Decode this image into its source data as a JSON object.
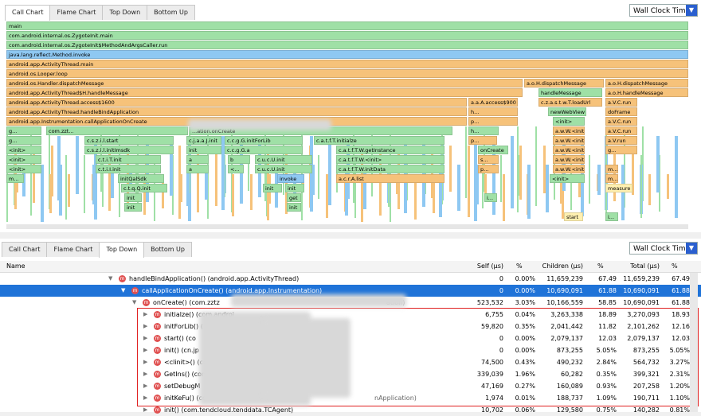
{
  "top_tabs": [
    "Call Chart",
    "Flame Chart",
    "Top Down",
    "Bottom Up"
  ],
  "clock_select": "Wall Clock Time",
  "bottom_tabs": [
    "Call Chart",
    "Flame Chart",
    "Top Down",
    "Bottom Up"
  ],
  "flame_rows": [
    [
      {
        "l": "main",
        "c": "g"
      }
    ],
    [
      {
        "l": "com.android.internal.os.ZygoteInit.main",
        "c": "g"
      }
    ],
    [
      {
        "l": "com.android.internal.os.ZygoteInit$MethodAndArgsCaller.run",
        "c": "g"
      }
    ],
    [
      {
        "l": "java.lang.reflect.Method.invoke",
        "c": "b"
      }
    ],
    [
      {
        "l": "android.app.ActivityThread.main",
        "c": "o"
      }
    ],
    [
      {
        "l": "android.os.Looper.loop",
        "c": "o"
      }
    ],
    [
      {
        "l": "android.os.Handler.dispatchMessage",
        "c": "o"
      },
      {
        "l": "a.o.H.dispatchMessage",
        "c": "o"
      },
      {
        "l": "a.o.H.dispatchMessage",
        "c": "o"
      }
    ],
    [
      {
        "l": "android.app.ActivityThread$H.handleMessage",
        "c": "o"
      },
      {
        "l": "handleMessage",
        "c": "g"
      },
      {
        "l": "a.o.H.handleMessage",
        "c": "o"
      }
    ],
    [
      {
        "l": "android.app.ActivityThread.access$1600",
        "c": "o"
      },
      {
        "l": "a.a.A.access$900",
        "c": "o"
      },
      {
        "l": "c.z.a.s.t.w.T.loadUrl",
        "c": "o"
      },
      {
        "l": "a.V.C.run",
        "c": "o"
      }
    ],
    [
      {
        "l": "android.app.ActivityThread.handleBindApplication",
        "c": "o"
      },
      {
        "l": "h...",
        "c": "o"
      },
      {
        "l": "newWebView",
        "c": "g"
      },
      {
        "l": "doFrame",
        "c": "o"
      }
    ],
    [
      {
        "l": "android.app.Instrumentation.callApplicationOnCreate",
        "c": "o"
      },
      {
        "l": "p...",
        "c": "o"
      },
      {
        "l": "<init>",
        "c": "g"
      },
      {
        "l": "a.V.C.run",
        "c": "o"
      }
    ],
    [
      {
        "l": "g...",
        "c": "g"
      },
      {
        "l": "com.zzt...",
        "c": "g"
      },
      {
        "l": "...ation.onCreate",
        "c": "g"
      },
      {
        "l": "h...",
        "c": "g"
      },
      {
        "l": "a.w.W.<init>",
        "c": "o"
      },
      {
        "l": "a.V.C.run",
        "c": "o"
      }
    ],
    [
      {
        "l": "g...",
        "c": "g"
      },
      {
        "l": "c.s.z.i.l.start",
        "c": "g"
      },
      {
        "l": "c.j.a.a.J.init",
        "c": "g"
      },
      {
        "l": "c.c.g.G.initForLib",
        "c": "g"
      },
      {
        "l": "c.a.t.f.T.initialze",
        "c": "g"
      },
      {
        "l": "p...",
        "c": "o"
      },
      {
        "l": "a.w.W.<init>",
        "c": "o"
      },
      {
        "l": "a.V.run",
        "c": "o"
      }
    ],
    [
      {
        "l": "<init>",
        "c": "g"
      },
      {
        "l": "c.s.z.i.l.initImsdk",
        "c": "g"
      },
      {
        "l": "init",
        "c": "g"
      },
      {
        "l": "c.c.g.G.a",
        "c": "g"
      },
      {
        "l": "c.a.t.f.T.W.getInstance",
        "c": "g"
      },
      {
        "l": "onCreate",
        "c": "g"
      },
      {
        "l": "a.w.W.<init>",
        "c": "o"
      },
      {
        "l": "g...",
        "c": "o"
      }
    ],
    [
      {
        "l": "<init>",
        "c": "g"
      },
      {
        "l": "c.t.i.T.init",
        "c": "g"
      },
      {
        "l": "a",
        "c": "g"
      },
      {
        "l": "b",
        "c": "g"
      },
      {
        "l": "c.u.c.U.init",
        "c": "g"
      },
      {
        "l": "c.a.t.f.T.W.<init>",
        "c": "g"
      },
      {
        "l": "s...",
        "c": "o"
      },
      {
        "l": "a.w.W.<init>",
        "c": "o"
      }
    ],
    [
      {
        "l": "<init>",
        "c": "g"
      },
      {
        "l": "c.t.i.I.init",
        "c": "g"
      },
      {
        "l": "a",
        "c": "g"
      },
      {
        "l": "<...",
        "c": "g"
      },
      {
        "l": "c.u.c.U.init",
        "c": "g"
      },
      {
        "l": "c.a.t.f.T.W.initData",
        "c": "g"
      },
      {
        "l": "p...",
        "c": "o"
      },
      {
        "l": "a.w.W.<init>",
        "c": "o"
      },
      {
        "l": "m...",
        "c": "o"
      }
    ],
    [
      {
        "l": "m...",
        "c": "g"
      },
      {
        "l": "initQalSdk",
        "c": "g"
      },
      {
        "l": "invoke",
        "c": "b"
      },
      {
        "l": "a.c.r.A.list",
        "c": "o"
      },
      {
        "l": "<init>",
        "c": "g"
      },
      {
        "l": "m...",
        "c": "o"
      }
    ],
    [
      {
        "l": "c.t.q.Q.init",
        "c": "g"
      },
      {
        "l": "init",
        "c": "g"
      },
      {
        "l": "init",
        "c": "g"
      },
      {
        "l": "measure",
        "c": "y"
      }
    ],
    [
      {
        "l": "init",
        "c": "g"
      },
      {
        "l": "get",
        "c": "g"
      },
      {
        "l": "i...",
        "c": "g"
      }
    ],
    [
      {
        "l": "init",
        "c": "g"
      },
      {
        "l": "init",
        "c": "g"
      }
    ],
    [
      {
        "l": "start",
        "c": "y"
      },
      {
        "l": "i...",
        "c": "g"
      }
    ]
  ],
  "table": {
    "headers": {
      "name": "Name",
      "self": "Self (μs)",
      "pct1": "%",
      "children": "Children (μs)",
      "pct2": "%",
      "total": "Total (μs)",
      "pct3": "%"
    },
    "rows": [
      {
        "name": "handleBindApplication() (android.app.ActivityThread)",
        "self": "0",
        "pct1": "0.00%",
        "children": "11,659,239",
        "pct2": "67.49",
        "total": "11,659,239",
        "pct3": "67.49"
      },
      {
        "name": "callApplicationOnCreate() (android.app.Instrumentation)",
        "self": "0",
        "pct1": "0.00%",
        "children": "10,690,091",
        "pct2": "61.88",
        "total": "10,690,091",
        "pct3": "61.88"
      },
      {
        "name": "onCreate() (com.zztz",
        "tail": "ation)",
        "self": "523,532",
        "pct1": "3.03%",
        "children": "10,166,559",
        "pct2": "58.85",
        "total": "10,690,091",
        "pct3": "61.88"
      },
      {
        "name": "initialze() (com.androi",
        "tail": "",
        "self": "6,755",
        "pct1": "0.04%",
        "children": "3,263,338",
        "pct2": "18.89",
        "total": "3,270,093",
        "pct3": "18.93"
      },
      {
        "name": "initForLib() (",
        "tail": "ation)",
        "self": "59,820",
        "pct1": "0.35%",
        "children": "2,041,442",
        "pct2": "11.82",
        "total": "2,101,262",
        "pct3": "12.16"
      },
      {
        "name": "start() (co",
        "tail": "",
        "self": "0",
        "pct1": "0.00%",
        "children": "2,079,137",
        "pct2": "12.03",
        "total": "2,079,137",
        "pct3": "12.03"
      },
      {
        "name": "init() (cn.jp",
        "tail": "e)",
        "self": "0",
        "pct1": "0.00%",
        "children": "873,255",
        "pct2": "5.05%",
        "total": "873,255",
        "pct3": "5.05%"
      },
      {
        "name": "<clinit>() (co",
        "tail": "ub)",
        "self": "74,500",
        "pct1": "0.43%",
        "children": "490,232",
        "pct2": "2.84%",
        "total": "564,732",
        "pct3": "3.27%"
      },
      {
        "name": "GetIns() (com",
        "tail": "",
        "self": "339,039",
        "pct1": "1.96%",
        "children": "60,282",
        "pct2": "0.35%",
        "total": "399,321",
        "pct3": "2.31%"
      },
      {
        "name": "setDebugM",
        "tail": "",
        "self": "47,169",
        "pct1": "0.27%",
        "children": "160,089",
        "pct2": "0.93%",
        "total": "207,258",
        "pct3": "1.20%"
      },
      {
        "name": "initKeFu() (com.z",
        "tail": "nApplication)",
        "self": "1,974",
        "pct1": "0.01%",
        "children": "188,737",
        "pct2": "1.09%",
        "total": "190,711",
        "pct3": "1.10%"
      },
      {
        "name": "init() (com.tendcloud.tenddata.TCAgent)",
        "tail": "",
        "self": "10,702",
        "pct1": "0.06%",
        "children": "129,580",
        "pct2": "0.75%",
        "total": "140,282",
        "pct3": "0.81%"
      }
    ]
  }
}
